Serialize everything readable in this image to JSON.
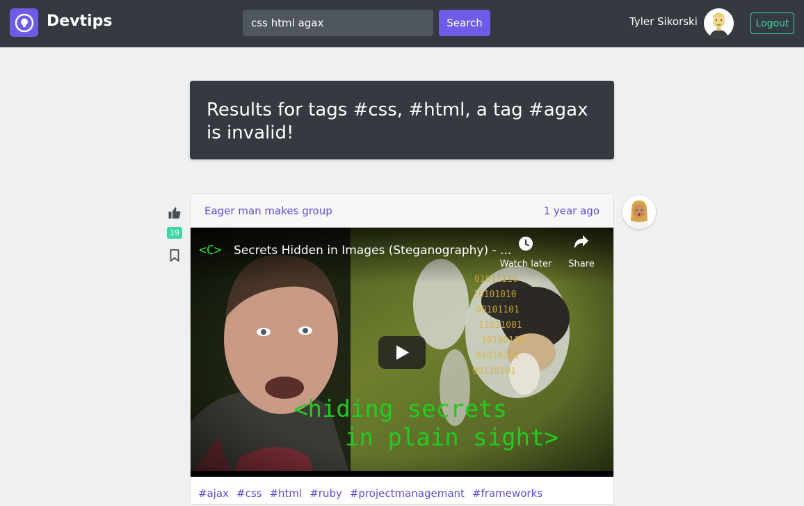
{
  "navbar": {
    "brand": "Devtips",
    "search": {
      "value": "css html agax",
      "button_label": "Search"
    },
    "user": {
      "name": "Tyler Sikorski",
      "avatar_icon": "user-avatar-icon"
    },
    "logout_label": "Logout",
    "colors": {
      "background": "#343a40",
      "accent": "#6c5ce7",
      "logout": "#3fd6a6"
    }
  },
  "results": {
    "message": "Results for tags #css, #html, a tag #agax is invalid!"
  },
  "post": {
    "votes": "19",
    "title": "Eager man makes group",
    "time": "1 year ago",
    "video": {
      "channel_logo": "<C>",
      "title": "Secrets Hidden in Images (Steganography) - ...",
      "watch_later_label": "Watch later",
      "share_label": "Share",
      "caption_line1": "<hiding secrets",
      "caption_line2": "in plain sight>",
      "binary_lines": [
        "01011110",
        "10101010",
        "00101101",
        "11011001",
        "10100110",
        "01010101",
        "00110101"
      ]
    },
    "tags": [
      "#ajax",
      "#css",
      "#html",
      "#ruby",
      "#projectmanagemant",
      "#frameworks"
    ]
  }
}
